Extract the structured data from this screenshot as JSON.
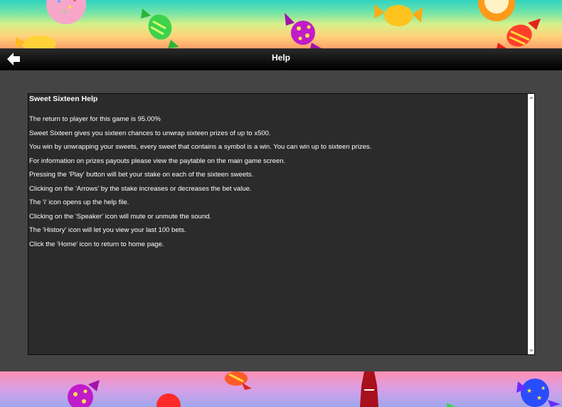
{
  "header": {
    "title": "Help",
    "back_icon": "arrow-left-icon"
  },
  "help": {
    "title": "Sweet Sixteen Help",
    "lines": [
      "The return to player for this game is 95.00%",
      "Sweet Sixteen gives you sixteen chances to unwrap sixteen prizes of up to x500.",
      "You win by unwrapping your sweets, every sweet that contains a symbol is a win. You can win up to sixteen prizes.",
      "For information on prizes payouts please view the paytable on the main game screen.",
      "Pressing the 'Play' button will bet your stake on each of the sixteen sweets.",
      "Clicking on the 'Arrows' by the stake increases or decreases the bet value.",
      "The 'i' icon opens up the help file.",
      "Clicking on the 'Speaker' icon will mute or unmute the sound.",
      "The 'History' icon will let you view your last 100 bets.",
      "Click the 'Home' icon to return to home page."
    ]
  },
  "colors": {
    "panel_bg": "#2b2b2b",
    "page_bg": "#444444",
    "text": "#ffffff"
  }
}
